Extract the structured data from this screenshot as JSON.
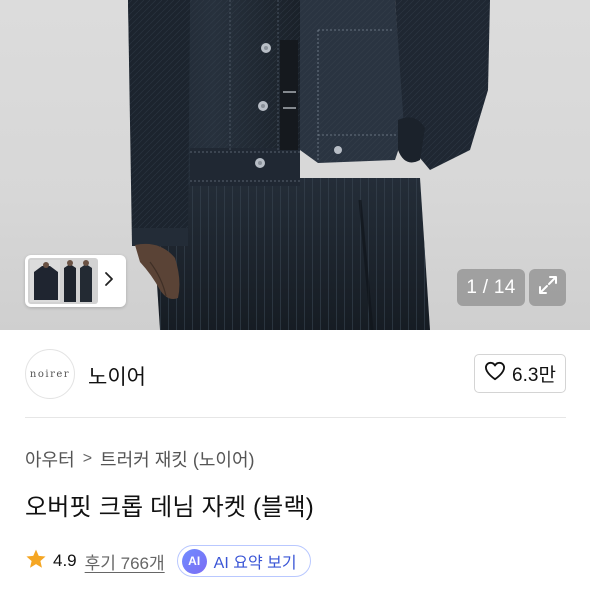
{
  "gallery": {
    "counter": "1 / 14",
    "icons": {
      "next": "chevron-right-icon",
      "expand": "expand-arrows-icon"
    }
  },
  "brand": {
    "logo_text": "noirer",
    "name": "노이어",
    "likes": "6.3만",
    "like_icon": "heart-outline-icon"
  },
  "breadcrumb": {
    "category": "아우터",
    "separator": ">",
    "subcategory": "트러커 재킷 (노이어)"
  },
  "product": {
    "title": "오버핏 크롭 데님 자켓 (블랙)"
  },
  "rating": {
    "score": "4.9",
    "reviews": "후기 766개",
    "star_color": "#f5a623"
  },
  "ai_summary": {
    "badge": "AI",
    "label": "AI 요약 보기",
    "accent": "#3a55d6"
  }
}
